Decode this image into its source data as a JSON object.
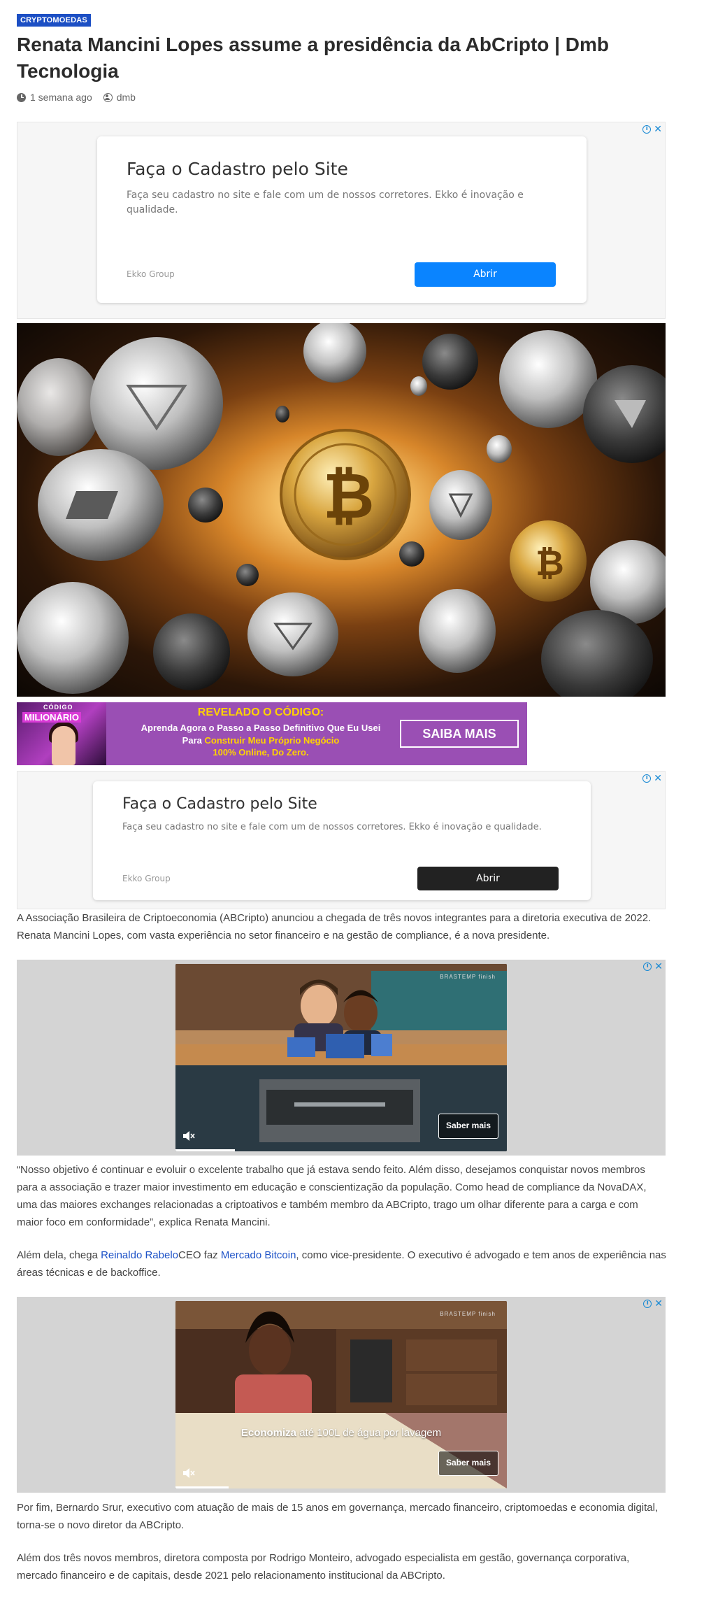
{
  "article": {
    "category": "CRYPTOMOEDAS",
    "title": "Renata Mancini Lopes assume a presidência da AbCripto | Dmb Tecnologia",
    "time_ago": "1 semana ago",
    "author": "dmb"
  },
  "ad1": {
    "headline": "Faça o Cadastro pelo Site",
    "description": "Faça seu cadastro no site e fale com um de nossos corretores. Ekko é inovação e qualidade.",
    "advertiser": "Ekko Group",
    "button": "Abrir",
    "button_color": "#0a84ff"
  },
  "ad2": {
    "headline": "Faça o Cadastro pelo Site",
    "description": "Faça seu cadastro no site e fale com um de nossos corretores. Ekko é inovação e qualidade.",
    "advertiser": "Ekko Group",
    "button": "Abrir",
    "button_color": "#222222"
  },
  "banner": {
    "logo_top": "CÓDIGO",
    "logo_main": "MILIONÁRIO",
    "heading": "REVELADO O CÓDIGO:",
    "line1": "Aprenda Agora o Passo a Passo Definitivo Que Eu Usei",
    "line2_prefix": "Para ",
    "line2_highlight": "Construir Meu Próprio Negócio",
    "line3": "100% Online, Do Zero.",
    "cta": "SAIBA MAIS"
  },
  "paragraphs": {
    "p1": "A Associação Brasileira de Criptoeconomia (ABCripto) anunciou a chegada de três novos integrantes para a diretoria executiva de 2022. Renata Mancini Lopes, com vasta experiência no setor financeiro e na gestão de compliance, é a nova presidente.",
    "p2": "“Nosso objetivo é continuar e evoluir o excelente trabalho que já estava sendo feito. Além disso, desejamos conquistar novos membros para a associação e trazer maior investimento em educação e conscientização da população. Como head de compliance da NovaDAX, uma das maiores exchanges relacionadas a criptoativos e também membro da ABCripto, trago um olhar diferente para a carga e com maior foco em conformidade”, explica Renata Mancini.",
    "p3_before": "Além dela, chega ",
    "p3_link1": "Reinaldo Rabelo",
    "p3_mid": "CEO faz ",
    "p3_link2": "Mercado Bitcoin",
    "p3_after": ", como vice-presidente. O executivo é advogado e tem anos de experiência nas áreas técnicas e de backoffice.",
    "p4": "Por fim, Bernardo Srur, executivo com atuação de mais de 15 anos em governança, mercado financeiro, criptomoedas e economia digital, torna-se o novo diretor da ABCripto.",
    "p5": "Além dos três novos membros, diretora composta por Rodrigo Monteiro, advogado especialista em gestão, governança corporativa, mercado financeiro e de capitais, desde 2021 pelo relacionamento institucional da ABCripto."
  },
  "video1": {
    "brand": "BRASTEMP  finish",
    "cta": "Saber mais",
    "progress": 0.18
  },
  "video2": {
    "brand": "BRASTEMP  finish",
    "caption_bold": "Economiza",
    "caption_rest": " até 100L de água por lavagem",
    "cta": "Saber mais",
    "progress": 0.16
  }
}
